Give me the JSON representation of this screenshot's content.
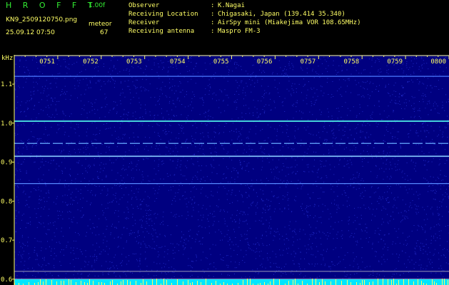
{
  "header": {
    "brand": "H R O F F T",
    "version": "1.00f",
    "filename": "KN9_2509120750.png",
    "datetime": "25.09.12 07:50",
    "meteor_label": "meteor",
    "meteor_count": "67",
    "info": [
      {
        "key": "Observer",
        "value": "K.Nagai"
      },
      {
        "key": "Receiving Location",
        "value": "Chigasaki, Japan (139.414 35.340)"
      },
      {
        "key": "Receiver",
        "value": "AirSpy mini (Miakejima VOR 108.65MHz)"
      },
      {
        "key": "Receiving antenna",
        "value": "Maspro FM-3"
      }
    ]
  },
  "chart_data": {
    "type": "heatmap",
    "ylabel": "kHz",
    "x_ticks": [
      "0751",
      "0752",
      "0753",
      "0754",
      "0755",
      "0756",
      "0757",
      "0758",
      "0759",
      "0800"
    ],
    "y_ticks": [
      1.1,
      1.0,
      0.9,
      0.8,
      0.7,
      0.6
    ],
    "ylim": [
      0.585,
      1.175
    ],
    "xlim_minutes": [
      0,
      10
    ],
    "grid": false,
    "carrier_lines_khz": [
      {
        "freq": 1.12,
        "color": "#4a7aff",
        "intensity": "medium"
      },
      {
        "freq": 1.005,
        "color": "#55ffee",
        "intensity": "strong"
      },
      {
        "freq": 0.948,
        "color": "#66aaff",
        "intensity": "medium-dashed"
      },
      {
        "freq": 0.915,
        "color": "#88ccff",
        "intensity": "strong"
      },
      {
        "freq": 0.845,
        "color": "#5588ff",
        "intensity": "medium"
      },
      {
        "freq": 0.62,
        "color": "#cccccc",
        "intensity": "reference"
      },
      {
        "freq": 0.6,
        "color": "#cccccc",
        "intensity": "reference"
      }
    ],
    "colors": {
      "background": "#000080",
      "noise": "#3a4aff",
      "axis": "#ffff66",
      "meteor_strip": "#00e5ff"
    }
  }
}
